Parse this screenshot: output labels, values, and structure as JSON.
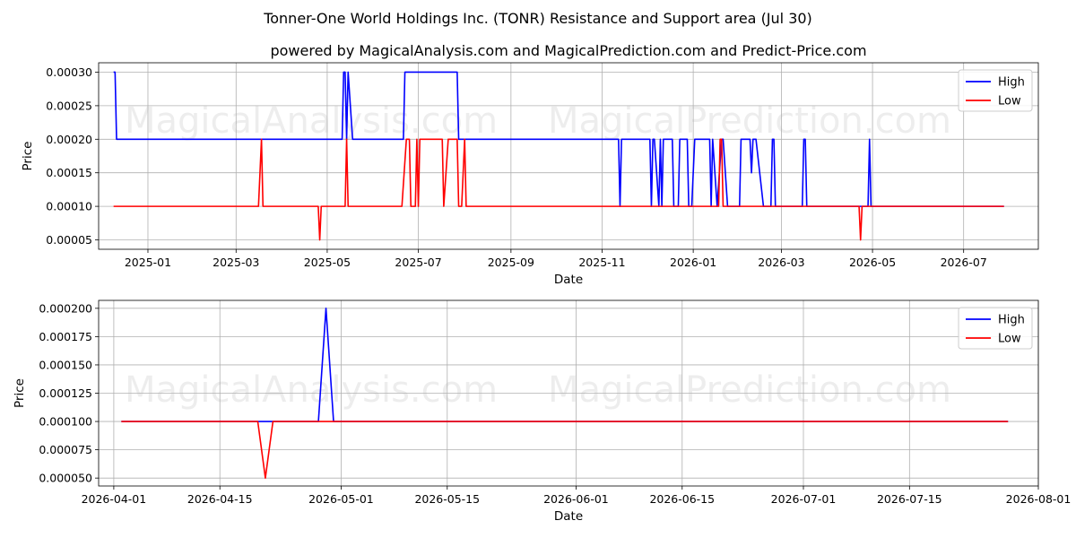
{
  "figure": {
    "title": "Tonner-One World Holdings Inc. (TONR) Resistance and Support area (Jul 30)",
    "watermarks": [
      "MagicalAnalysis.com",
      "MagicalPrediction.com"
    ]
  },
  "colors": {
    "high": "#0000ff",
    "low": "#ff0000",
    "grid": "#b0b0b0",
    "axis": "#000000"
  },
  "chart_data": [
    {
      "type": "line",
      "title": "powered by MagicalAnalysis.com and MagicalPrediction.com and Predict-Price.com",
      "xlabel": "Date",
      "ylabel": "Price",
      "xlim": [
        "2024-11-29",
        "2026-08-20"
      ],
      "ylim": [
        3.6e-05,
        0.000314
      ],
      "x_ticks": [
        "2025-01-01",
        "2025-03-01",
        "2025-05-01",
        "2025-07-01",
        "2025-09-01",
        "2025-11-01",
        "2026-01-01",
        "2026-03-01",
        "2026-05-01",
        "2026-07-01"
      ],
      "x_tick_labels": [
        "2025-01",
        "2025-03",
        "2025-05",
        "2025-07",
        "2025-09",
        "2025-11",
        "2026-01",
        "2026-03",
        "2026-05",
        "2026-07"
      ],
      "y_ticks": [
        5e-05,
        0.0001,
        0.00015,
        0.0002,
        0.00025,
        0.0003
      ],
      "y_tick_labels": [
        "0.00005",
        "0.00010",
        "0.00015",
        "0.00020",
        "0.00025",
        "0.00030"
      ],
      "grid": true,
      "legend_position": "top-right",
      "series": [
        {
          "name": "High",
          "color": "#0000ff",
          "points": [
            [
              "2024-12-09",
              0.0003
            ],
            [
              "2024-12-10",
              0.0003
            ],
            [
              "2024-12-11",
              0.0002
            ],
            [
              "2025-05-11",
              0.0002
            ],
            [
              "2025-05-12",
              0.0003
            ],
            [
              "2025-05-13",
              0.0003
            ],
            [
              "2025-05-14",
              0.0002
            ],
            [
              "2025-05-15",
              0.0003
            ],
            [
              "2025-05-18",
              0.0002
            ],
            [
              "2025-06-21",
              0.0002
            ],
            [
              "2025-06-22",
              0.0003
            ],
            [
              "2025-07-27",
              0.0003
            ],
            [
              "2025-07-28",
              0.0002
            ],
            [
              "2025-11-12",
              0.0002
            ],
            [
              "2025-11-13",
              0.0001
            ],
            [
              "2025-11-14",
              0.0002
            ],
            [
              "2025-12-03",
              0.0002
            ],
            [
              "2025-12-04",
              0.0001
            ],
            [
              "2025-12-05",
              0.0002
            ],
            [
              "2025-12-06",
              0.0002
            ],
            [
              "2025-12-09",
              0.0001
            ],
            [
              "2025-12-10",
              0.0002
            ],
            [
              "2025-12-11",
              0.0001
            ],
            [
              "2025-12-12",
              0.0002
            ],
            [
              "2025-12-18",
              0.0002
            ],
            [
              "2025-12-19",
              0.0001
            ],
            [
              "2025-12-22",
              0.0001
            ],
            [
              "2025-12-23",
              0.0002
            ],
            [
              "2025-12-28",
              0.0002
            ],
            [
              "2025-12-29",
              0.0001
            ],
            [
              "2025-12-31",
              0.0001
            ],
            [
              "2026-01-02",
              0.0002
            ],
            [
              "2026-01-12",
              0.0002
            ],
            [
              "2026-01-13",
              0.0001
            ],
            [
              "2026-01-14",
              0.0002
            ],
            [
              "2026-01-17",
              0.0001
            ],
            [
              "2026-01-20",
              0.0002
            ],
            [
              "2026-01-21",
              0.0002
            ],
            [
              "2026-01-24",
              0.0001
            ],
            [
              "2026-02-01",
              0.0001
            ],
            [
              "2026-02-02",
              0.0002
            ],
            [
              "2026-02-08",
              0.0002
            ],
            [
              "2026-02-09",
              0.00015
            ],
            [
              "2026-02-10",
              0.0002
            ],
            [
              "2026-02-12",
              0.0002
            ],
            [
              "2026-02-17",
              0.0001
            ],
            [
              "2026-02-22",
              0.0001
            ],
            [
              "2026-02-23",
              0.0002
            ],
            [
              "2026-02-24",
              0.0002
            ],
            [
              "2026-02-25",
              0.0001
            ],
            [
              "2026-03-15",
              0.0001
            ],
            [
              "2026-03-16",
              0.0002
            ],
            [
              "2026-03-17",
              0.0002
            ],
            [
              "2026-03-18",
              0.0001
            ],
            [
              "2026-04-28",
              0.0001
            ],
            [
              "2026-04-29",
              0.0002
            ],
            [
              "2026-04-30",
              0.0001
            ],
            [
              "2026-07-28",
              0.0001
            ]
          ]
        },
        {
          "name": "Low",
          "color": "#ff0000",
          "points": [
            [
              "2024-12-09",
              0.0001
            ],
            [
              "2025-03-16",
              0.0001
            ],
            [
              "2025-03-18",
              0.0002
            ],
            [
              "2025-03-19",
              0.0001
            ],
            [
              "2025-04-25",
              0.0001
            ],
            [
              "2025-04-26",
              5e-05
            ],
            [
              "2025-04-27",
              0.0001
            ],
            [
              "2025-05-13",
              0.0001
            ],
            [
              "2025-05-14",
              0.0002
            ],
            [
              "2025-05-15",
              0.0001
            ],
            [
              "2025-06-20",
              0.0001
            ],
            [
              "2025-06-23",
              0.0002
            ],
            [
              "2025-06-25",
              0.0002
            ],
            [
              "2025-06-26",
              0.0001
            ],
            [
              "2025-06-29",
              0.0001
            ],
            [
              "2025-06-30",
              0.0002
            ],
            [
              "2025-07-01",
              0.0001
            ],
            [
              "2025-07-02",
              0.0002
            ],
            [
              "2025-07-17",
              0.0002
            ],
            [
              "2025-07-18",
              0.0001
            ],
            [
              "2025-07-21",
              0.0002
            ],
            [
              "2025-07-27",
              0.0002
            ],
            [
              "2025-07-28",
              0.0001
            ],
            [
              "2025-07-30",
              0.0001
            ],
            [
              "2025-08-01",
              0.0002
            ],
            [
              "2025-08-02",
              0.0001
            ],
            [
              "2026-01-18",
              0.0001
            ],
            [
              "2026-01-19",
              0.0002
            ],
            [
              "2026-01-20",
              0.0002
            ],
            [
              "2026-01-21",
              0.0001
            ],
            [
              "2026-04-22",
              0.0001
            ],
            [
              "2026-04-23",
              5e-05
            ],
            [
              "2026-04-24",
              0.0001
            ],
            [
              "2026-07-28",
              0.0001
            ]
          ]
        }
      ]
    },
    {
      "type": "line",
      "title": "",
      "xlabel": "Date",
      "ylabel": "Price",
      "xlim": [
        "2026-03-30",
        "2026-08-01"
      ],
      "ylim": [
        4.3e-05,
        0.000207
      ],
      "x_ticks": [
        "2026-04-01",
        "2026-04-15",
        "2026-05-01",
        "2026-05-15",
        "2026-06-01",
        "2026-06-15",
        "2026-07-01",
        "2026-07-15",
        "2026-08-01"
      ],
      "x_tick_labels": [
        "2026-04-01",
        "2026-04-15",
        "2026-05-01",
        "2026-05-15",
        "2026-06-01",
        "2026-06-15",
        "2026-07-01",
        "2026-07-15",
        "2026-08-01"
      ],
      "y_ticks": [
        5e-05,
        7.5e-05,
        0.0001,
        0.000125,
        0.00015,
        0.000175,
        0.0002
      ],
      "y_tick_labels": [
        "0.000050",
        "0.000075",
        "0.000100",
        "0.000125",
        "0.000150",
        "0.000175",
        "0.000200"
      ],
      "grid": true,
      "legend_position": "top-right",
      "series": [
        {
          "name": "High",
          "color": "#0000ff",
          "points": [
            [
              "2026-04-02",
              0.0001
            ],
            [
              "2026-04-28",
              0.0001
            ],
            [
              "2026-04-29",
              0.0002
            ],
            [
              "2026-04-30",
              0.0001
            ],
            [
              "2026-07-28",
              0.0001
            ]
          ]
        },
        {
          "name": "Low",
          "color": "#ff0000",
          "points": [
            [
              "2026-04-02",
              0.0001
            ],
            [
              "2026-04-20",
              0.0001
            ],
            [
              "2026-04-21",
              5e-05
            ],
            [
              "2026-04-22",
              0.0001
            ],
            [
              "2026-07-28",
              0.0001
            ]
          ]
        }
      ]
    }
  ]
}
